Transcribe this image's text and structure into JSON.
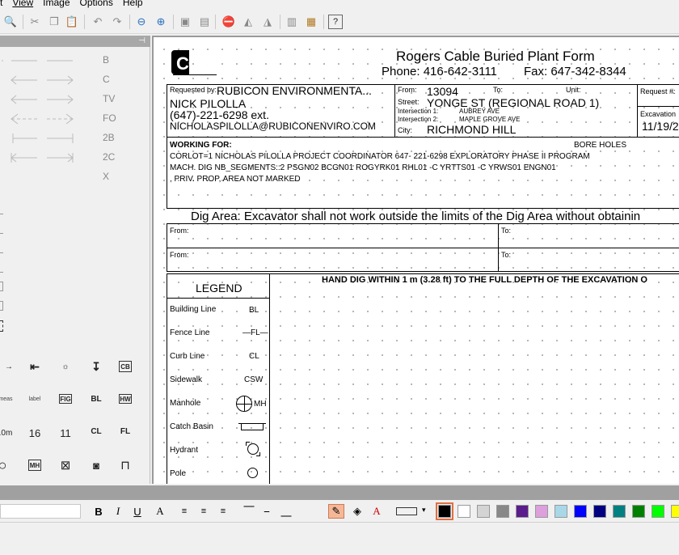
{
  "menu": [
    {
      "label": "t",
      "ul": ""
    },
    {
      "label": "View",
      "ul": "V"
    },
    {
      "label": "Image",
      "ul": "I"
    },
    {
      "label": "Options",
      "ul": "O"
    },
    {
      "label": "Help",
      "ul": "H"
    }
  ],
  "line_styles": [
    "B",
    "C",
    "TV",
    "FO",
    "2B",
    "2C",
    "X"
  ],
  "symbol_labels": {
    "cb": "CB",
    "fig": "FIG",
    "bl": "BL",
    "hw": "HW",
    "val16": "16",
    "val11": "11",
    "cl": "CL",
    "fl": "FL",
    "mh": "MH",
    "dim": ".0m",
    "meas": "meas",
    "label": "label"
  },
  "form": {
    "title": "Rogers Cable Buried Plant Form",
    "phone": "Phone: 416-642-3111",
    "fax": "Fax: 647-342-8344",
    "logo": "CCS",
    "requested_by_label": "Requested by:",
    "requested_by_company": "RUBICON ENVIRONMENTA...",
    "contact_name": "NICK PILOLLA",
    "contact_phone": "(647)-221-6298 ext.",
    "contact_email": "NICHOLASPILOLLA@RUBICONENVIRO.COM",
    "from_label": "From:",
    "from_value": "13094",
    "to_label": "To:",
    "unit_label": "Unit:",
    "street_label": "Street:",
    "street_value": "YONGE ST (REGIONAL ROAD 1)",
    "intersection1_label": "Intersection 1:",
    "intersection1_value": "AUBREY AVE",
    "intersection2_label": "Intersection 2:",
    "intersection2_value": "MAPLE GROVE AVE",
    "city_label": "City:",
    "city_value": "RICHMOND HILL",
    "request_label": "Request #:",
    "excavation_label": "Excavation",
    "excavation_value": "11/19/2",
    "working_for_label": "WORKING FOR:",
    "bore_holes": "BORE HOLES",
    "work_line1": "CORLOT=1 NICHOLAS PILOLLA PROJECT COORDINATOR 647- 221-6298 EXPLORATORY PHASE II PROGRAM",
    "work_line2": "MACH. DIG NB_SEGMENTS::2 PSGN02 BCGN01 ROGYRK01 RHL01    -C YRTTS01  -C YRWS01 ENGN01",
    "work_line3": ", PRIV. PROP, AREA NOT MARKED",
    "dig_area": "Dig Area: Excavator shall not work outside the limits of the Dig Area without obtainin",
    "dig_from1": "From:",
    "dig_to1": "To:",
    "dig_from2": "From:",
    "dig_to2": "To:",
    "hand_dig": "HAND DIG WITHIN 1 m (3.28 ft) TO THE FULL DEPTH OF THE EXCAVATION O",
    "legend_title": "LEGEND",
    "legend": [
      {
        "name": "Building Line",
        "code": "BL"
      },
      {
        "name": "Fence Line",
        "code": "—FL—"
      },
      {
        "name": "Curb Line",
        "code": "CL"
      },
      {
        "name": "Sidewalk",
        "code": "CSW"
      },
      {
        "name": "Manhole",
        "code": "MH"
      },
      {
        "name": "Catch Basin",
        "code": ""
      },
      {
        "name": "Hydrant",
        "code": ""
      },
      {
        "name": "Pole",
        "code": ""
      }
    ]
  },
  "colors": {
    "palette": [
      "#000000",
      "#ffffff",
      "#d4d4d4",
      "#888888",
      "#5a1e8c",
      "#dda0dd",
      "#a8d8e8",
      "#0000ff",
      "#000080",
      "#008080",
      "#008000",
      "#00ff00",
      "#ffff00"
    ]
  }
}
